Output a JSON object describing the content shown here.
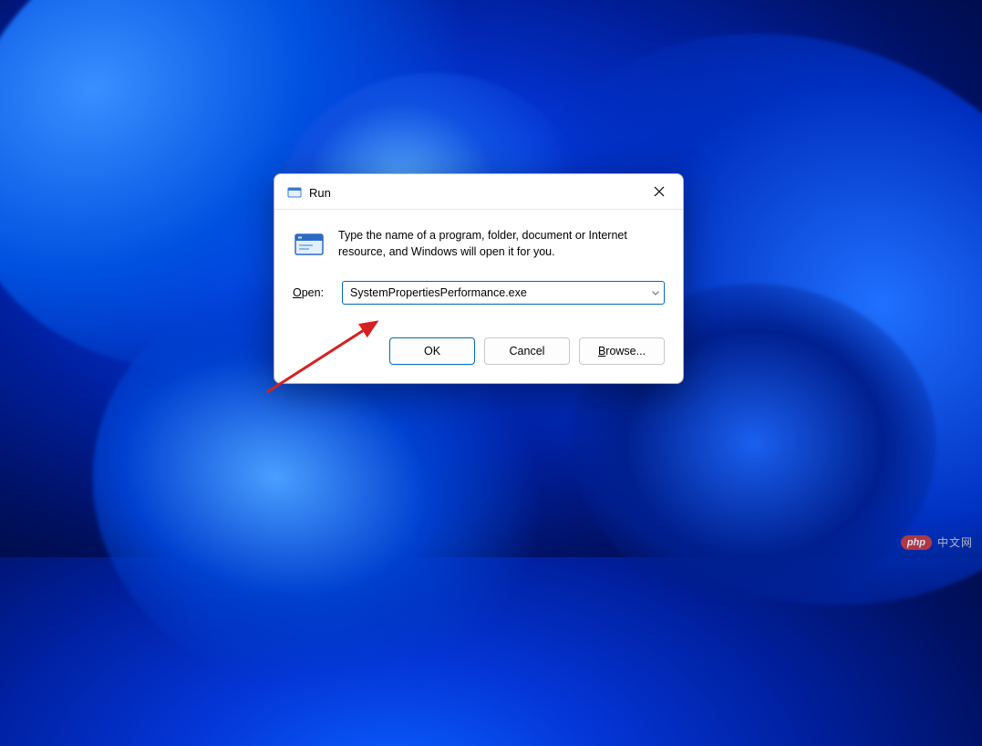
{
  "dialog": {
    "title": "Run",
    "description": "Type the name of a program, folder, document or Internet resource, and Windows will open it for you.",
    "open_label_prefix": "O",
    "open_label_rest": "pen:",
    "input_value": "SystemPropertiesPerformance.exe",
    "buttons": {
      "ok": "OK",
      "cancel": "Cancel",
      "browse_prefix": "B",
      "browse_rest": "rowse..."
    }
  },
  "watermark": {
    "logo": "php",
    "text": "中文网"
  },
  "colors": {
    "accent": "#0067c0",
    "background_blue": "#0436d8"
  }
}
